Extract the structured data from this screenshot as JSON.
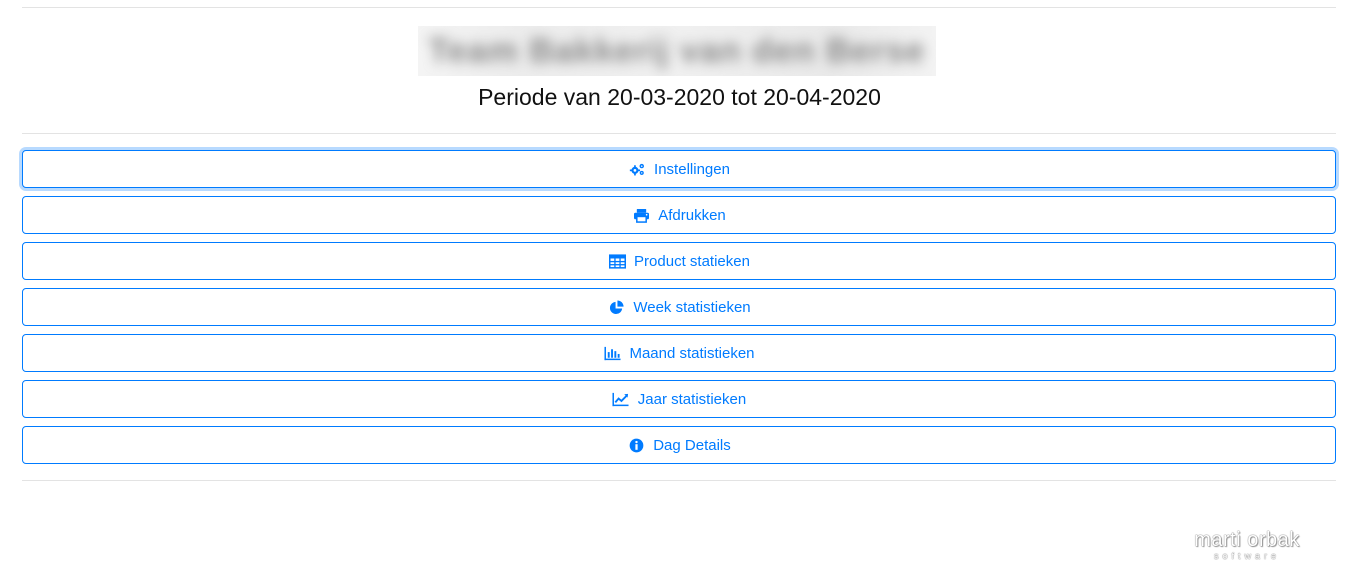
{
  "header": {
    "title_blurred": "Team Bakkerij van den Berse",
    "period_text": "Periode van 20-03-2020 tot 20-04-2020"
  },
  "menu": {
    "items": [
      {
        "label": "Instellingen",
        "icon": "gears-icon"
      },
      {
        "label": "Afdrukken",
        "icon": "print-icon"
      },
      {
        "label": "Product statieken",
        "icon": "table-icon"
      },
      {
        "label": "Week statistieken",
        "icon": "pie-chart-icon"
      },
      {
        "label": "Maand statistieken",
        "icon": "bar-chart-icon"
      },
      {
        "label": "Jaar statistieken",
        "icon": "line-chart-icon"
      },
      {
        "label": "Dag Details",
        "icon": "info-icon"
      }
    ]
  },
  "branding": {
    "logo_text": "marti orbak",
    "logo_sub": "software"
  },
  "colors": {
    "primary": "#007bff",
    "divider": "#e3e3e3"
  }
}
